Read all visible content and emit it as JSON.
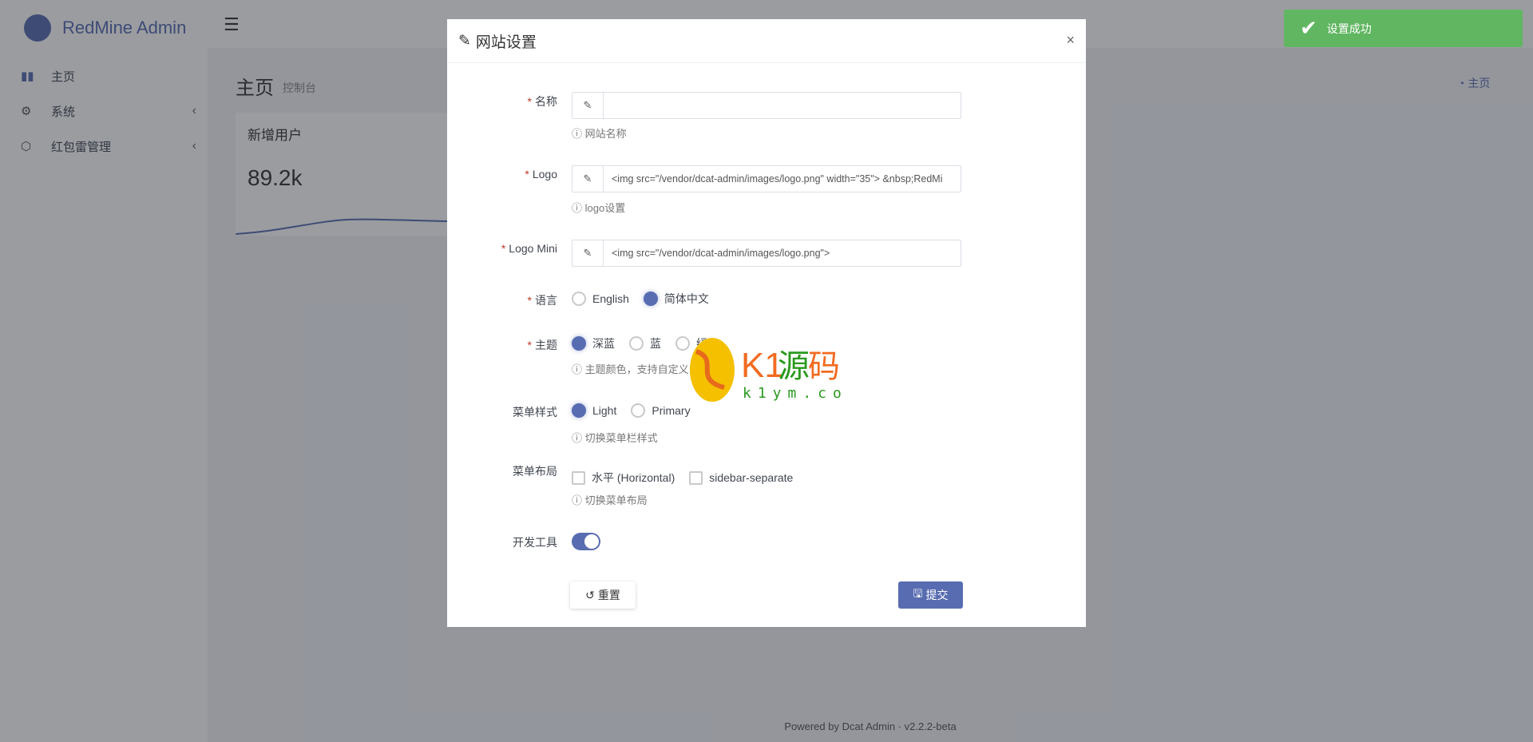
{
  "app": {
    "brand": "RedMine Admin"
  },
  "sidebar": {
    "items": [
      {
        "label": "主页",
        "icon": "bar-chart-icon"
      },
      {
        "label": "系统",
        "icon": "gear-icon"
      },
      {
        "label": "红包雷管理",
        "icon": "box-icon"
      }
    ]
  },
  "content": {
    "title": "主页",
    "subtitle": "控制台",
    "breadcrumb": "主页",
    "card": {
      "title": "新增用户",
      "value": "89.2k"
    }
  },
  "footer": {
    "powered": "Powered by Dcat Admin",
    "version": "v2.2.2-beta"
  },
  "toast": {
    "message": "设置成功",
    "color": "#5cb85c"
  },
  "modal": {
    "title": "网站设置",
    "fields": {
      "name": {
        "label": "名称",
        "value": "",
        "help": "网站名称"
      },
      "logo": {
        "label": "Logo",
        "value": "<img src=\"/vendor/dcat-admin/images/logo.png\" width=\"35\"> &nbsp;RedMi",
        "help": "logo设置"
      },
      "logo_mini": {
        "label": "Logo Mini",
        "value": "<img src=\"/vendor/dcat-admin/images/logo.png\">"
      },
      "lang": {
        "label": "语言",
        "options": [
          "English",
          "简体中文"
        ],
        "selected": "简体中文"
      },
      "theme": {
        "label": "主题",
        "options": [
          "深蓝",
          "蓝",
          "绿"
        ],
        "selected": "深蓝",
        "help": "主题颜色，支持自定义！"
      },
      "menu_style": {
        "label": "菜单样式",
        "options": [
          "Light",
          "Primary"
        ],
        "selected": "Light",
        "help": "切换菜单栏样式"
      },
      "menu_layout": {
        "label": "菜单布局",
        "options": [
          "水平 (Horizontal)",
          "sidebar-separate"
        ],
        "help": "切换菜单布局"
      },
      "dev_tools": {
        "label": "开发工具",
        "enabled": true
      }
    },
    "reset_label": "重置",
    "submit_label": "提交"
  },
  "watermark": {
    "text": "K1源码",
    "url": "k1ym.com"
  },
  "accent": "#586cb1"
}
